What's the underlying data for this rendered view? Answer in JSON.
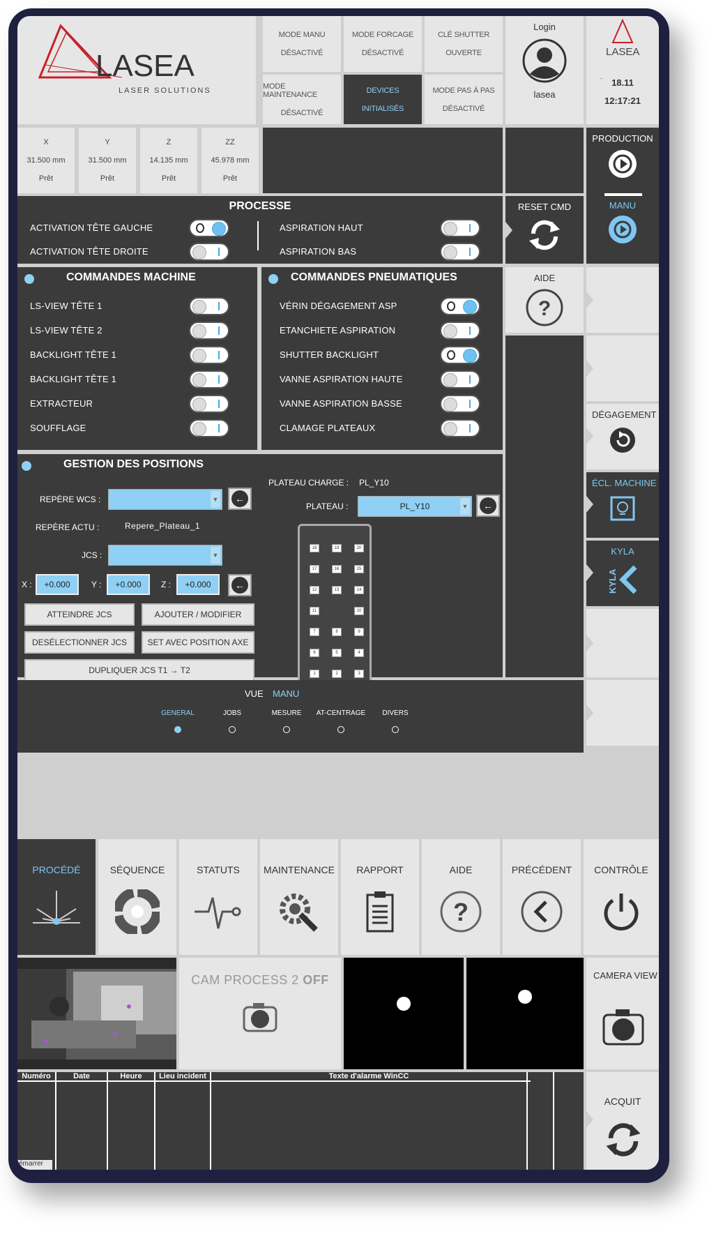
{
  "header": {
    "logo": {
      "name": "LASEA",
      "tagline": "LASER SOLUTIONS"
    },
    "modes": [
      {
        "title": "MODE MANU",
        "state": "DÉSACTIVÉ"
      },
      {
        "title": "MODE FORCAGE",
        "state": "DÉSACTIVÉ"
      },
      {
        "title": "CLÉ SHUTTER",
        "state": "OUVERTE"
      },
      {
        "title": "MODE MAINTENANCE",
        "state": "DÉSACTIVÉ"
      },
      {
        "title": "DEVICES",
        "state": "INITIALISÉS"
      },
      {
        "title": "MODE PAS À PAS",
        "state": "DÉSACTIVÉ"
      }
    ],
    "login": {
      "label": "Login",
      "user": "lasea"
    },
    "clock": {
      "logo": "LASEA",
      "marker": "`",
      "date": "18.11",
      "time": "12:17:21"
    }
  },
  "axes": [
    {
      "name": "X",
      "value": "31.500 mm",
      "status": "Prêt"
    },
    {
      "name": "Y",
      "value": "31.500 mm",
      "status": "Prêt"
    },
    {
      "name": "Z",
      "value": "14.135 mm",
      "status": "Prêt"
    },
    {
      "name": "ZZ",
      "value": "45.978 mm",
      "status": "Prêt"
    }
  ],
  "right_nav": {
    "production": "PRODUCTION",
    "manu": "MANU",
    "reset_cmd": "RESET CMD",
    "aide": "AIDE",
    "degagement": "DÉGAGEMENT",
    "eclairage": "ÉCL. MACHINE",
    "kyla": "KYLA",
    "kyla_logo": "KYLA"
  },
  "processe": {
    "title": "PROCESSE",
    "left": [
      {
        "label": "ACTIVATION TÊTE GAUCHE",
        "on": true
      },
      {
        "label": "ACTIVATION TÊTE DROITE",
        "on": false
      }
    ],
    "right": [
      {
        "label": "ASPIRATION HAUT",
        "on": false
      },
      {
        "label": "ASPIRATION BAS",
        "on": false
      }
    ]
  },
  "machine": {
    "title": "COMMANDES MACHINE",
    "items": [
      {
        "label": "LS-VIEW TÊTE 1",
        "on": false
      },
      {
        "label": "LS-VIEW TÊTE 2",
        "on": false
      },
      {
        "label": "BACKLIGHT TÊTE 1",
        "on": false
      },
      {
        "label": "BACKLIGHT TÊTE 1",
        "on": false
      },
      {
        "label": "EXTRACTEUR",
        "on": false
      },
      {
        "label": "SOUFFLAGE",
        "on": false
      }
    ]
  },
  "pneumatic": {
    "title": "COMMANDES PNEUMATIQUES",
    "items": [
      {
        "label": "VÉRIN DÉGAGEMENT ASP",
        "on": true
      },
      {
        "label": "ETANCHIETE ASPIRATION",
        "on": false
      },
      {
        "label": "SHUTTER BACKLIGHT",
        "on": true
      },
      {
        "label": "VANNE ASPIRATION HAUTE",
        "on": false
      },
      {
        "label": "VANNE ASPIRATION BASSE",
        "on": false
      },
      {
        "label": "CLAMAGE PLATEAUX",
        "on": false
      }
    ]
  },
  "positions": {
    "title": "GESTION DES POSITIONS",
    "wcs_label": "REPÈRE WCS :",
    "actu_label": "REPÈRE ACTU :",
    "actu_value": "Repere_Plateau_1",
    "jcs_label": "JCS :",
    "x_label": "X :",
    "x_value": "+0.000",
    "y_label": "Y :",
    "y_value": "+0.000",
    "z_label": "Z :",
    "z_value": "+0.000",
    "buttons": {
      "atteindre": "ATTEINDRE JCS",
      "ajouter": "AJOUTER / MODIFIER",
      "deselect": "DESÉLECTIONNER JCS",
      "set_axe": "SET AVEC POSITION AXE",
      "dupliquer": "DUPLIQUER JCS T1 → T2"
    },
    "plateau_charge_label": "PLATEAU CHARGE :",
    "plateau_charge_value": "PL_Y10",
    "plateau_label": "PLATEAU :",
    "plateau_value": "PL_Y10",
    "slots": [
      [
        "18",
        "19",
        "20"
      ],
      [
        "17",
        "16",
        "15"
      ],
      [
        "12",
        "13",
        "14"
      ],
      [
        "11",
        "",
        "10"
      ],
      [
        "7",
        "8",
        "9"
      ],
      [
        "6",
        "5",
        "4"
      ],
      [
        "1",
        "2",
        "3"
      ]
    ]
  },
  "vue": {
    "label": "VUE",
    "value": "MANU",
    "tabs": [
      "GENERAL",
      "JOBS",
      "MESURE",
      "AT-CENTRAGE",
      "DIVERS"
    ],
    "selected": 0
  },
  "nav": {
    "items": [
      "PROCÉDÉ",
      "SÉQUENCE",
      "STATUTS",
      "MAINTENANCE",
      "RAPPORT",
      "AIDE",
      "PRÉCÉDENT",
      "CONTRÔLE"
    ],
    "selected": 0
  },
  "cameras": {
    "cam2_label": "CAM PROCESS 2",
    "cam2_state": "OFF",
    "camera_view": "CAMERA VIEW"
  },
  "alarms": {
    "columns": [
      "Numéro",
      "Date",
      "Heure",
      "Lieu incident",
      "Texte d'alarme WinCC"
    ],
    "start_button": "émarrer",
    "acquit": "ACQUIT"
  },
  "colors": {
    "accent": "#8fd0f4",
    "panel": "#3b3b3b",
    "tile": "#e6e6e6",
    "logo_red": "#c8202a"
  }
}
